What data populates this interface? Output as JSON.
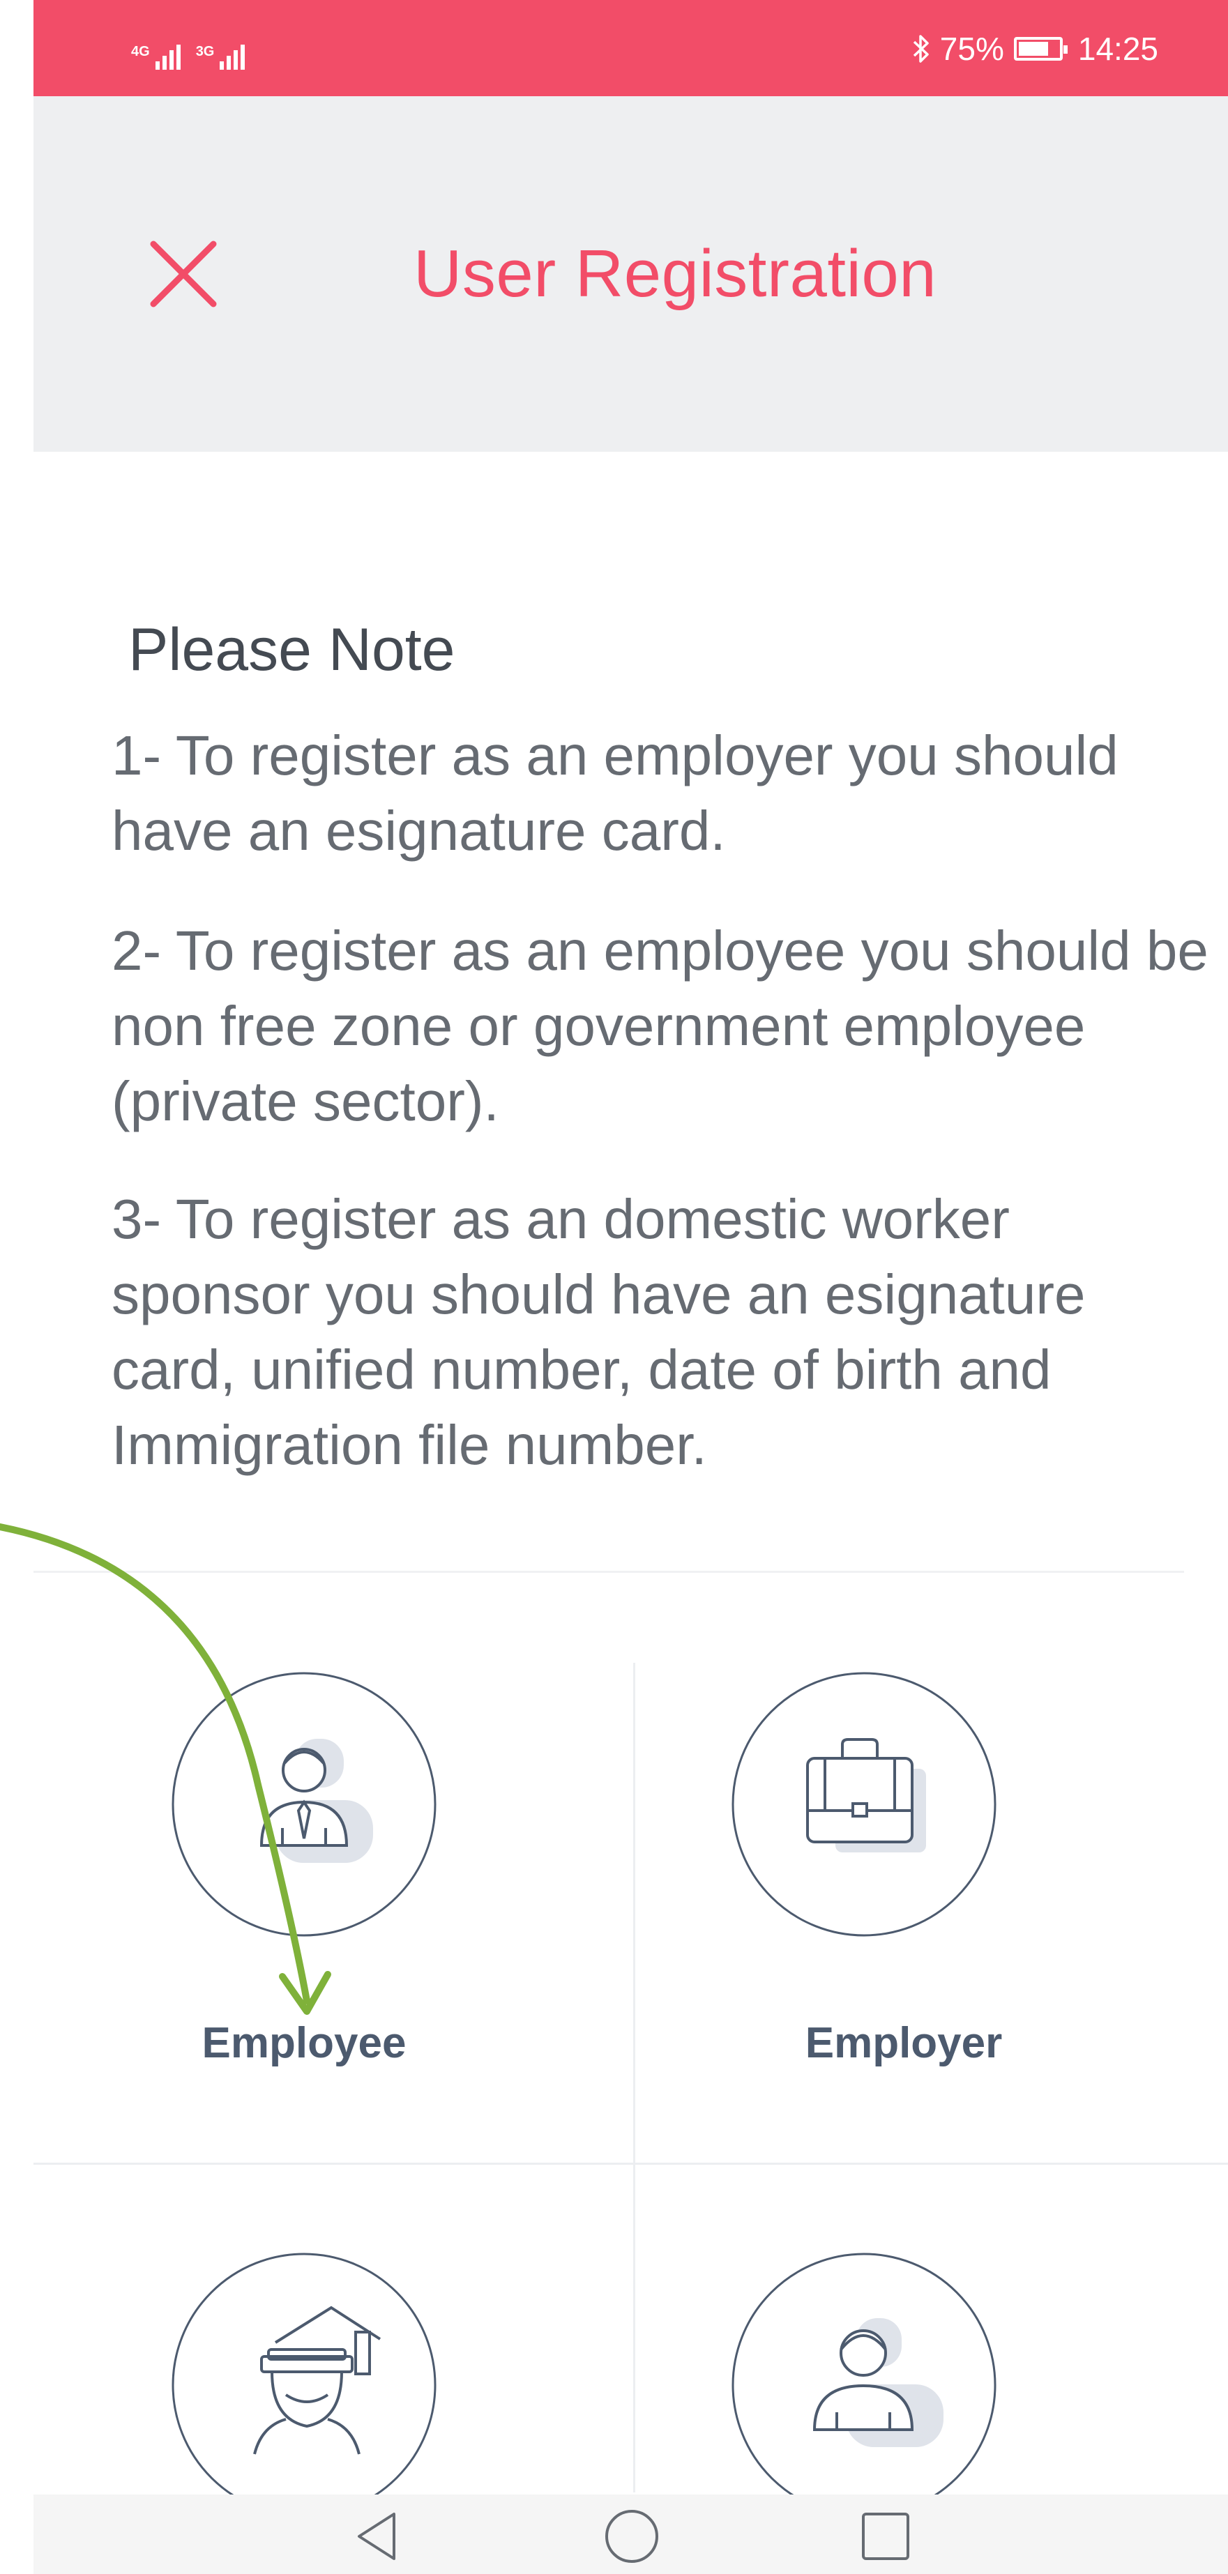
{
  "status_bar": {
    "network_1": "4G",
    "network_2": "3G",
    "bluetooth_icon": "bluetooth-icon",
    "battery_percent": "75%",
    "battery_level": 0.75,
    "time": "14:25"
  },
  "header": {
    "title": "User Registration",
    "close_icon": "close-icon"
  },
  "note": {
    "title": "Please Note",
    "items": [
      "1- To register as an employer you should have an esignature card.",
      "2- To register as an employee you should be non free zone or government employee (private sector).",
      "3- To register as an domestic worker sponsor you should have an esignature card, unified number, date of birth and Immigration file number."
    ]
  },
  "options": [
    {
      "label": "Employee",
      "icon": "employee-icon"
    },
    {
      "label": "Employer",
      "icon": "briefcase-icon"
    },
    {
      "label": "",
      "icon": "domestic-worker-sponsor-icon"
    },
    {
      "label": "",
      "icon": "user-icon"
    }
  ],
  "annotation": {
    "arrow_color": "#7fb13a",
    "points_to": "Employee"
  },
  "colors": {
    "accent": "#f24d68",
    "header_bg": "#eeeff1",
    "label": "#4c5a6e",
    "icon_stroke": "#4c5a6e"
  },
  "nav_bar": {
    "icons": [
      "back-icon",
      "home-icon",
      "recents-icon"
    ]
  }
}
